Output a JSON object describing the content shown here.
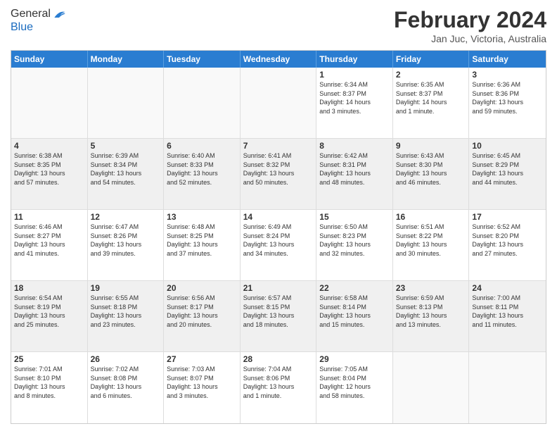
{
  "logo": {
    "general": "General",
    "blue": "Blue"
  },
  "header": {
    "title": "February 2024",
    "subtitle": "Jan Juc, Victoria, Australia"
  },
  "dayHeaders": [
    "Sunday",
    "Monday",
    "Tuesday",
    "Wednesday",
    "Thursday",
    "Friday",
    "Saturday"
  ],
  "weeks": [
    [
      {
        "num": "",
        "info": "",
        "empty": true
      },
      {
        "num": "",
        "info": "",
        "empty": true
      },
      {
        "num": "",
        "info": "",
        "empty": true
      },
      {
        "num": "",
        "info": "",
        "empty": true
      },
      {
        "num": "1",
        "info": "Sunrise: 6:34 AM\nSunset: 8:37 PM\nDaylight: 14 hours\nand 3 minutes.",
        "empty": false
      },
      {
        "num": "2",
        "info": "Sunrise: 6:35 AM\nSunset: 8:37 PM\nDaylight: 14 hours\nand 1 minute.",
        "empty": false
      },
      {
        "num": "3",
        "info": "Sunrise: 6:36 AM\nSunset: 8:36 PM\nDaylight: 13 hours\nand 59 minutes.",
        "empty": false
      }
    ],
    [
      {
        "num": "4",
        "info": "Sunrise: 6:38 AM\nSunset: 8:35 PM\nDaylight: 13 hours\nand 57 minutes.",
        "empty": false
      },
      {
        "num": "5",
        "info": "Sunrise: 6:39 AM\nSunset: 8:34 PM\nDaylight: 13 hours\nand 54 minutes.",
        "empty": false
      },
      {
        "num": "6",
        "info": "Sunrise: 6:40 AM\nSunset: 8:33 PM\nDaylight: 13 hours\nand 52 minutes.",
        "empty": false
      },
      {
        "num": "7",
        "info": "Sunrise: 6:41 AM\nSunset: 8:32 PM\nDaylight: 13 hours\nand 50 minutes.",
        "empty": false
      },
      {
        "num": "8",
        "info": "Sunrise: 6:42 AM\nSunset: 8:31 PM\nDaylight: 13 hours\nand 48 minutes.",
        "empty": false
      },
      {
        "num": "9",
        "info": "Sunrise: 6:43 AM\nSunset: 8:30 PM\nDaylight: 13 hours\nand 46 minutes.",
        "empty": false
      },
      {
        "num": "10",
        "info": "Sunrise: 6:45 AM\nSunset: 8:29 PM\nDaylight: 13 hours\nand 44 minutes.",
        "empty": false
      }
    ],
    [
      {
        "num": "11",
        "info": "Sunrise: 6:46 AM\nSunset: 8:27 PM\nDaylight: 13 hours\nand 41 minutes.",
        "empty": false
      },
      {
        "num": "12",
        "info": "Sunrise: 6:47 AM\nSunset: 8:26 PM\nDaylight: 13 hours\nand 39 minutes.",
        "empty": false
      },
      {
        "num": "13",
        "info": "Sunrise: 6:48 AM\nSunset: 8:25 PM\nDaylight: 13 hours\nand 37 minutes.",
        "empty": false
      },
      {
        "num": "14",
        "info": "Sunrise: 6:49 AM\nSunset: 8:24 PM\nDaylight: 13 hours\nand 34 minutes.",
        "empty": false
      },
      {
        "num": "15",
        "info": "Sunrise: 6:50 AM\nSunset: 8:23 PM\nDaylight: 13 hours\nand 32 minutes.",
        "empty": false
      },
      {
        "num": "16",
        "info": "Sunrise: 6:51 AM\nSunset: 8:22 PM\nDaylight: 13 hours\nand 30 minutes.",
        "empty": false
      },
      {
        "num": "17",
        "info": "Sunrise: 6:52 AM\nSunset: 8:20 PM\nDaylight: 13 hours\nand 27 minutes.",
        "empty": false
      }
    ],
    [
      {
        "num": "18",
        "info": "Sunrise: 6:54 AM\nSunset: 8:19 PM\nDaylight: 13 hours\nand 25 minutes.",
        "empty": false
      },
      {
        "num": "19",
        "info": "Sunrise: 6:55 AM\nSunset: 8:18 PM\nDaylight: 13 hours\nand 23 minutes.",
        "empty": false
      },
      {
        "num": "20",
        "info": "Sunrise: 6:56 AM\nSunset: 8:17 PM\nDaylight: 13 hours\nand 20 minutes.",
        "empty": false
      },
      {
        "num": "21",
        "info": "Sunrise: 6:57 AM\nSunset: 8:15 PM\nDaylight: 13 hours\nand 18 minutes.",
        "empty": false
      },
      {
        "num": "22",
        "info": "Sunrise: 6:58 AM\nSunset: 8:14 PM\nDaylight: 13 hours\nand 15 minutes.",
        "empty": false
      },
      {
        "num": "23",
        "info": "Sunrise: 6:59 AM\nSunset: 8:13 PM\nDaylight: 13 hours\nand 13 minutes.",
        "empty": false
      },
      {
        "num": "24",
        "info": "Sunrise: 7:00 AM\nSunset: 8:11 PM\nDaylight: 13 hours\nand 11 minutes.",
        "empty": false
      }
    ],
    [
      {
        "num": "25",
        "info": "Sunrise: 7:01 AM\nSunset: 8:10 PM\nDaylight: 13 hours\nand 8 minutes.",
        "empty": false
      },
      {
        "num": "26",
        "info": "Sunrise: 7:02 AM\nSunset: 8:08 PM\nDaylight: 13 hours\nand 6 minutes.",
        "empty": false
      },
      {
        "num": "27",
        "info": "Sunrise: 7:03 AM\nSunset: 8:07 PM\nDaylight: 13 hours\nand 3 minutes.",
        "empty": false
      },
      {
        "num": "28",
        "info": "Sunrise: 7:04 AM\nSunset: 8:06 PM\nDaylight: 13 hours\nand 1 minute.",
        "empty": false
      },
      {
        "num": "29",
        "info": "Sunrise: 7:05 AM\nSunset: 8:04 PM\nDaylight: 12 hours\nand 58 minutes.",
        "empty": false
      },
      {
        "num": "",
        "info": "",
        "empty": true
      },
      {
        "num": "",
        "info": "",
        "empty": true
      }
    ]
  ]
}
